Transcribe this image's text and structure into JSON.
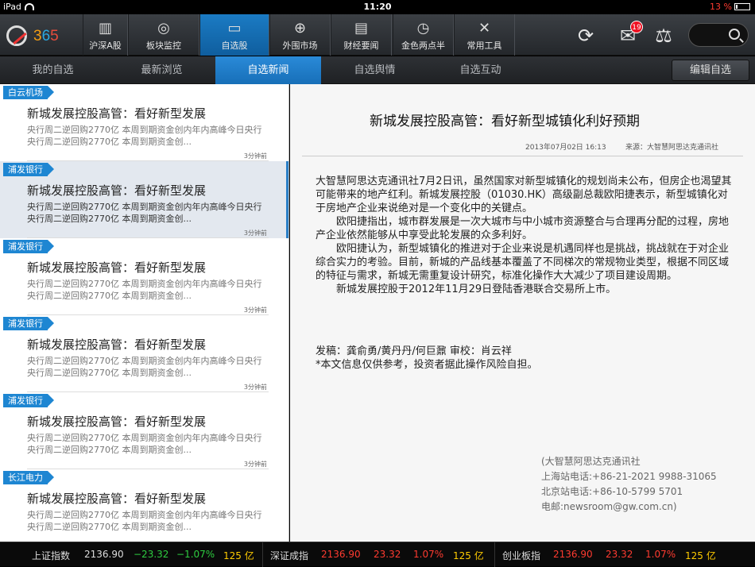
{
  "status_bar": {
    "device": "iPad",
    "time": "11:20",
    "battery": "13 %",
    "battery_level": 0.13
  },
  "logo": {
    "chars": [
      "3",
      "6",
      "5"
    ]
  },
  "top_nav": [
    {
      "label": "沪深A股",
      "icon": "chart-bar-icon",
      "glyph": "▥"
    },
    {
      "label": "板块监控",
      "icon": "pulse-monitor-icon",
      "glyph": "◎"
    },
    {
      "label": "自选股",
      "icon": "folder-icon",
      "glyph": "▭",
      "active": true
    },
    {
      "label": "外围市场",
      "icon": "globe-icon",
      "glyph": "⊕"
    },
    {
      "label": "财经要闻",
      "icon": "newspaper-icon",
      "glyph": "▤"
    },
    {
      "label": "金色两点半",
      "icon": "stopwatch-icon",
      "glyph": "◷"
    },
    {
      "label": "常用工具",
      "icon": "tools-icon",
      "glyph": "✕"
    }
  ],
  "tools": {
    "mail_badge": "19"
  },
  "sub_nav": {
    "tabs": [
      "我的自选",
      "最新浏览",
      "自选新闻",
      "自选舆情",
      "自选互动"
    ],
    "active": 2,
    "edit_label": "编辑自选"
  },
  "news": [
    {
      "tag": "白云机场",
      "title": "新城发展控股高管：看好新型发展",
      "summary": "央行周二逆回购2770亿 本周到期资金创内年内高峰今日央行央行周二逆回购2770亿 本周到期资金创...",
      "time": "3分钟前"
    },
    {
      "tag": "浦发银行",
      "title": "新城发展控股高管：看好新型发展",
      "summary": "央行周二逆回购2770亿 本周到期资金创内年内高峰今日央行央行周二逆回购2770亿 本周到期资金创...",
      "time": "3分钟前",
      "selected": true
    },
    {
      "tag": "浦发银行",
      "title": "新城发展控股高管：看好新型发展",
      "summary": "央行周二逆回购2770亿 本周到期资金创内年内高峰今日央行央行周二逆回购2770亿 本周到期资金创...",
      "time": "3分钟前"
    },
    {
      "tag": "浦发银行",
      "title": "新城发展控股高管：看好新型发展",
      "summary": "央行周二逆回购2770亿 本周到期资金创内年内高峰今日央行央行周二逆回购2770亿 本周到期资金创...",
      "time": "3分钟前"
    },
    {
      "tag": "浦发银行",
      "title": "新城发展控股高管：看好新型发展",
      "summary": "央行周二逆回购2770亿 本周到期资金创内年内高峰今日央行央行周二逆回购2770亿 本周到期资金创...",
      "time": "3分钟前"
    },
    {
      "tag": "长江电力",
      "title": "新城发展控股高管：看好新型发展",
      "summary": "央行周二逆回购2770亿 本周到期资金创内年内高峰今日央行央行周二逆回购2770亿 本周到期资金创...",
      "time": ""
    }
  ],
  "article": {
    "title": "新城发展控股高管：看好新型城镇化利好预期",
    "date": "2013年07月02日 16:13",
    "source": "来源：大智慧阿思达克通讯社",
    "paragraphs": [
      "大智慧阿思达克通讯社7月2日讯，虽然国家对新型城镇化的规划尚未公布，但房企也渴望其可能带来的地产红利。新城发展控股（01030.HK）高级副总裁欧阳捷表示，新型城镇化对于房地产企业来说绝对是一个变化中的关键点。",
      "欧阳捷指出，城市群发展是一次大城市与中小城市资源整合与合理再分配的过程，房地产企业依然能够从中享受此轮发展的众多利好。",
      "欧阳捷认为，新型城镇化的推进对于企业来说是机遇同样也是挑战，挑战就在于对企业综合实力的考验。目前，新城的产品线基本覆盖了不同梯次的常规物业类型，根据不同区域的特征与需求，新城无需重复设计研究，标准化操作大大减少了项目建设周期。",
      "新城发展控股于2012年11月29日登陆香港联合交易所上市。"
    ],
    "author": "发稿：龚俞勇/黄丹丹/何巨鼐 审校：肖云祥",
    "disclaimer": "*本文信息仅供参考，投资者据此操作风险自担。",
    "contact": [
      "(大智慧阿思达克通讯社",
      "上海站电话:+86-21-2021 9988-31065",
      "北京站电话:+86-10-5799 5701",
      "电邮:newsroom@gw.com.cn)"
    ]
  },
  "ticker": [
    {
      "name": "上证指数",
      "price": "2136.90",
      "change": "−23.32",
      "pct": "−1.07%",
      "vol": "125 亿"
    },
    {
      "name": "深证成指",
      "price": "2136.90",
      "change": "23.32",
      "pct": "1.07%",
      "vol": "125 亿"
    },
    {
      "name": "创业板指",
      "price": "2136.90",
      "change": "23.32",
      "pct": "1.07%",
      "vol": "125 亿"
    }
  ],
  "colors": {
    "accent": "#1e86d2",
    "up": "#ff3b30",
    "down": "#2ecc40",
    "volume": "#ffcc00"
  }
}
